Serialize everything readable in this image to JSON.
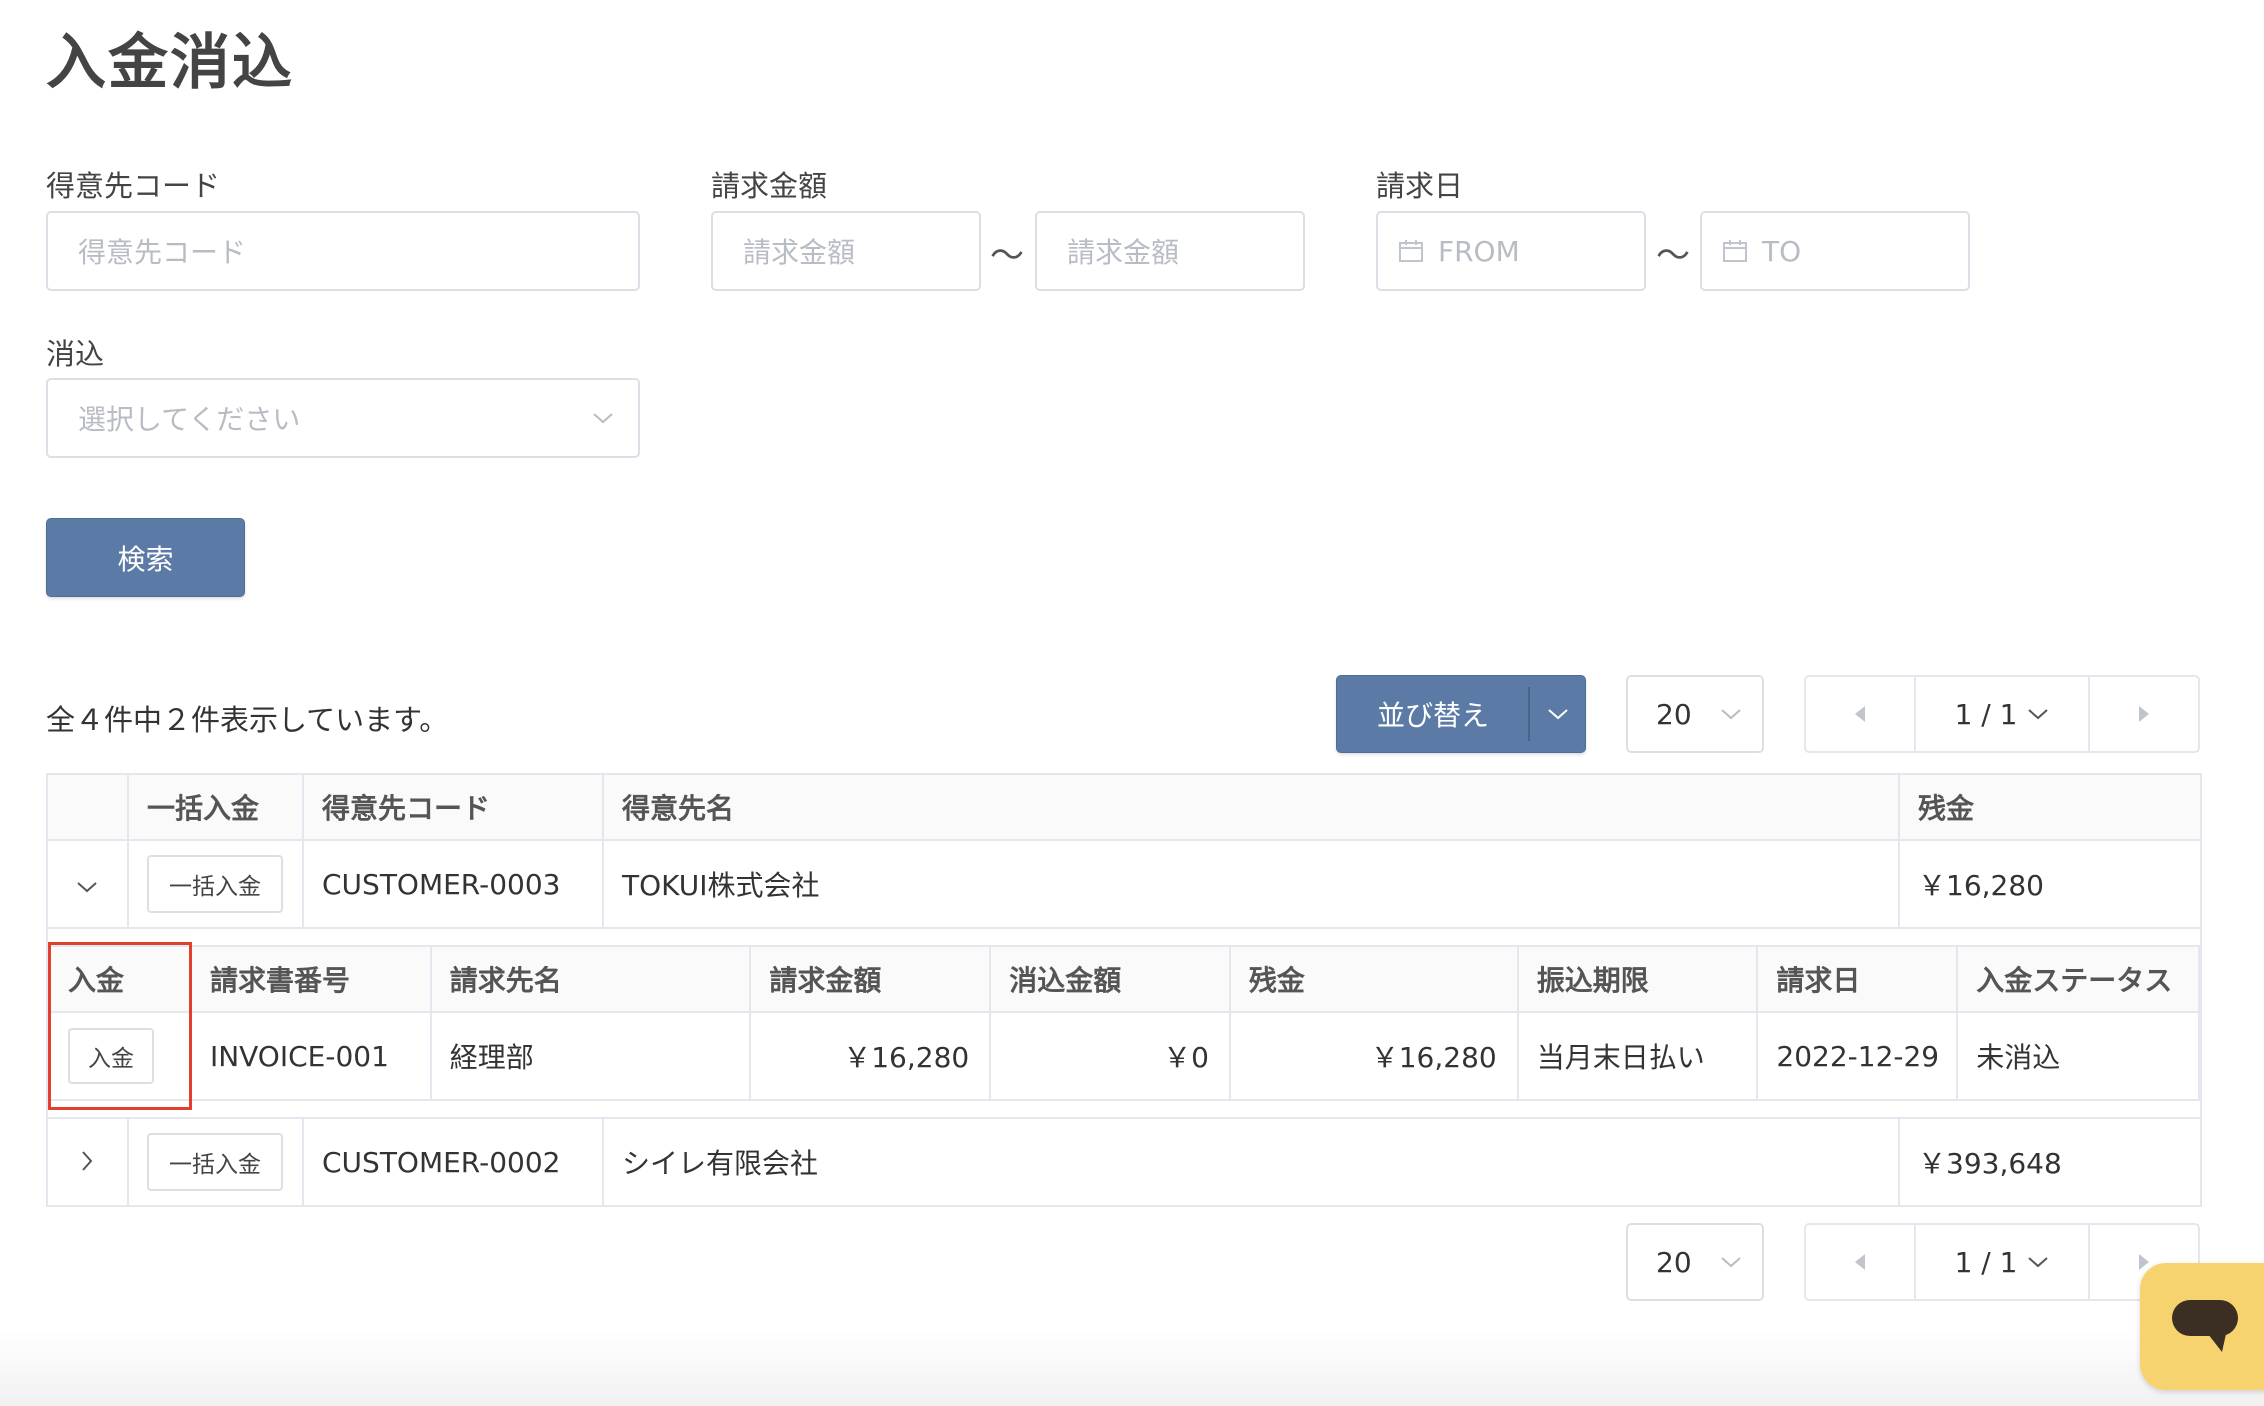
{
  "page": {
    "title": "入金消込"
  },
  "filters": {
    "customer_code": {
      "label": "得意先コード",
      "placeholder": "得意先コード"
    },
    "amount": {
      "label": "請求金額",
      "from_placeholder": "請求金額",
      "to_placeholder": "請求金額",
      "separator": "～"
    },
    "billing_date": {
      "label": "請求日",
      "from_placeholder": "FROM",
      "to_placeholder": "TO",
      "separator": "～"
    },
    "reconcile": {
      "label": "消込",
      "placeholder": "選択してください"
    },
    "search_button": "検索"
  },
  "results": {
    "summary": "全４件中２件表示しています。",
    "sort_button": "並び替え",
    "page_size": "20",
    "page_indicator": "1 / 1"
  },
  "table": {
    "headers": [
      "",
      "一括入金",
      "得意先コード",
      "得意先名",
      "残金"
    ],
    "rows": [
      {
        "bulk_button": "一括入金",
        "customer_code": "CUSTOMER-0003",
        "customer_name": "TOKUI株式会社",
        "balance": "￥16,280",
        "expanded": true
      },
      {
        "bulk_button": "一括入金",
        "customer_code": "CUSTOMER-0002",
        "customer_name": "シイレ有限会社",
        "balance": "￥393,648",
        "expanded": false
      }
    ],
    "detail": {
      "headers": [
        "入金",
        "請求書番号",
        "請求先名",
        "請求金額",
        "消込金額",
        "残金",
        "振込期限",
        "請求日",
        "入金ステータス"
      ],
      "rows": [
        {
          "pay_button": "入金",
          "invoice_no": "INVOICE-001",
          "bill_to": "経理部",
          "amount": "￥16,280",
          "reconciled": "￥0",
          "balance": "￥16,280",
          "due": "当月末日払い",
          "date": "2022-12-29",
          "status": "未消込"
        }
      ]
    }
  },
  "bottom_pager": {
    "page_size": "20",
    "page_indicator": "1 / 1"
  },
  "colors": {
    "primary": "#5b7aa5",
    "highlight": "#e0402f",
    "chat": "#f7d36f"
  },
  "icons": [
    "calendar-icon",
    "chevron-down-icon",
    "chevron-right-icon",
    "caret-left-icon",
    "caret-right-icon",
    "chat-icon"
  ]
}
